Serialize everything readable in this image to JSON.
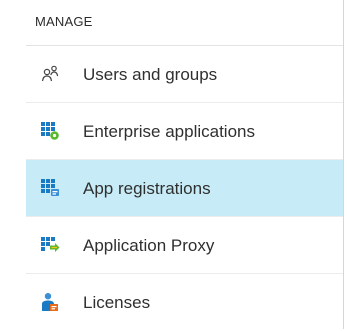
{
  "section": {
    "title": "MANAGE"
  },
  "menu": {
    "items": [
      {
        "label": "Users and groups",
        "icon": "users-icon",
        "selected": false
      },
      {
        "label": "Enterprise applications",
        "icon": "enterprise-apps-icon",
        "selected": false
      },
      {
        "label": "App registrations",
        "icon": "app-registrations-icon",
        "selected": true
      },
      {
        "label": "Application Proxy",
        "icon": "application-proxy-icon",
        "selected": false
      },
      {
        "label": "Licenses",
        "icon": "licenses-icon",
        "selected": false
      }
    ]
  },
  "colors": {
    "selected_background": "#c7ecf8",
    "icon_blue": "#1a7bc4",
    "icon_green": "#5cb82e",
    "icon_orange": "#e86a1b"
  }
}
